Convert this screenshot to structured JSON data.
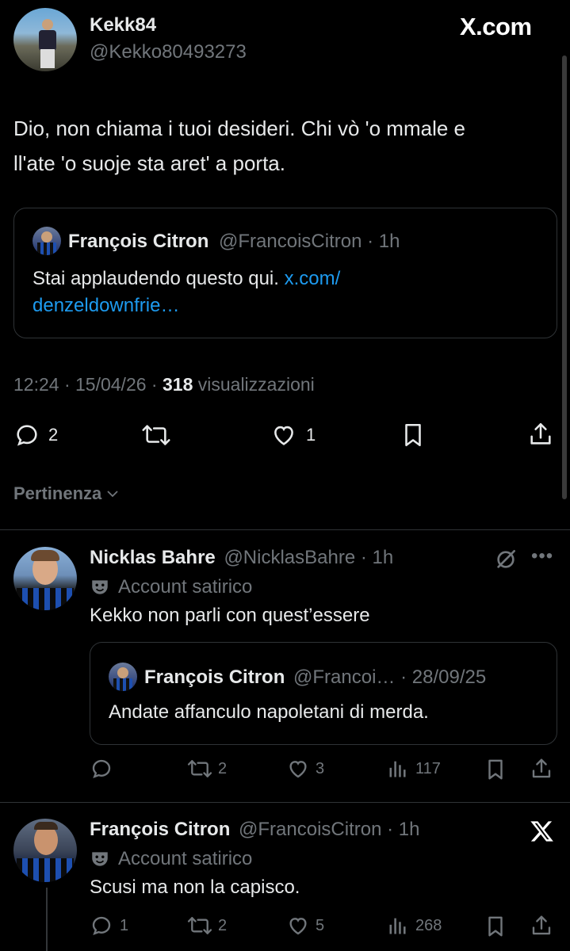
{
  "watermark": "X.com",
  "main_post": {
    "author_name": "Kekk84",
    "author_handle": "@Kekko80493273",
    "text_line1": "Dio, non chiama i tuoi desideri. Chi vò 'o mmale e",
    "text_line2": "ll'ate 'o suoje sta aret' a porta.",
    "quote": {
      "author_name": "François Citron",
      "author_handle": "@FrancoisCitron",
      "time": "· 1h",
      "text": "Stai applaudendo questo qui.",
      "link_line1": "x.com/",
      "link_line2": "denzeldownfrie…"
    },
    "meta": {
      "time": "12:24",
      "date": "· 15/04/26 ·",
      "views_count": "318",
      "views_label": "visualizzazioni"
    },
    "actions": {
      "replies": "2",
      "likes": "1"
    }
  },
  "sort": {
    "label": "Pertinenza"
  },
  "replies": [
    {
      "author_name": "Nicklas Bahre",
      "author_handle": "@NicklasBahre",
      "time": "· 1h",
      "badge": "Account satirico",
      "text": "Kekko non parli con quest’essere",
      "quote": {
        "author_name": "François Citron",
        "author_handle": "@Francoi…",
        "time": "· 28/09/25",
        "text": "Andate affanculo napoletani di merda."
      },
      "stats": {
        "replies": "",
        "reposts": "2",
        "likes": "3",
        "views": "117"
      }
    },
    {
      "author_name": "François Citron",
      "author_handle": "@FrancoisCitron",
      "time": "· 1h",
      "badge": "Account satirico",
      "text": "Scusi ma non la capisco.",
      "stats": {
        "replies": "1",
        "reposts": "2",
        "likes": "5",
        "views": "268"
      }
    }
  ],
  "colors": {
    "background": "#000000",
    "text": "#e7e9ea",
    "muted": "#71767b",
    "link": "#1d9bf0",
    "border": "#2f3336"
  }
}
